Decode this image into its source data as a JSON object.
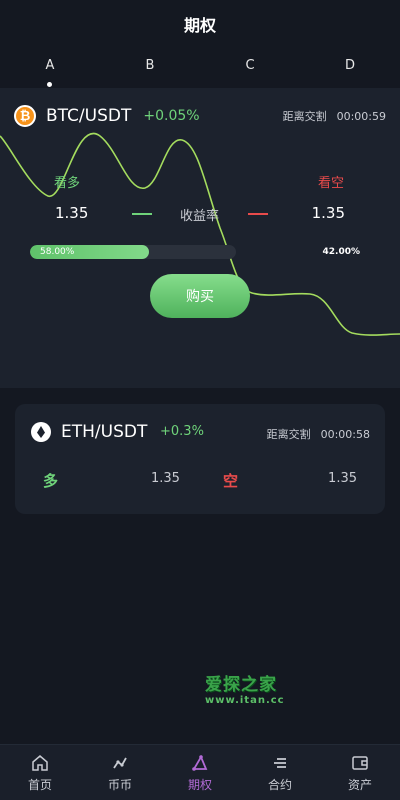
{
  "header": {
    "title": "期权"
  },
  "tabs": [
    {
      "label": "A",
      "active": true
    },
    {
      "label": "B"
    },
    {
      "label": "C"
    },
    {
      "label": "D"
    }
  ],
  "main_card": {
    "coin_icon": "bitcoin-icon",
    "pair": "BTC/USDT",
    "change": "+0.05%",
    "countdown_label": "距离交割",
    "countdown_time": "00:00:59",
    "long_label": "看多",
    "short_label": "看空",
    "long_rate": "1.35",
    "short_rate": "1.35",
    "rate_label": "收益率",
    "long_percent_text": "58.00%",
    "short_percent_text": "42.00%",
    "long_fraction": 0.58,
    "buy_label": "购买"
  },
  "eth_card": {
    "coin_icon": "ethereum-icon",
    "pair": "ETH/USDT",
    "change": "+0.3%",
    "countdown_label": "距离交割",
    "countdown_time": "00:00:58",
    "long_label": "多",
    "long_rate": "1.35",
    "short_label": "空",
    "short_rate": "1.35"
  },
  "watermark": {
    "logo": "爱探之家",
    "url": "www.itan.cc"
  },
  "bottom_nav": [
    {
      "label": "首页",
      "icon": "home-icon"
    },
    {
      "label": "币币",
      "icon": "trade-icon"
    },
    {
      "label": "期权",
      "icon": "options-icon",
      "active": true
    },
    {
      "label": "合约",
      "icon": "contract-icon"
    },
    {
      "label": "资产",
      "icon": "wallet-icon"
    }
  ],
  "colors": {
    "background": "#141821",
    "card": "#1c222d",
    "up_green": "#6fd37a",
    "down_red": "#e84b4b",
    "nav_active": "#b26bd6"
  }
}
